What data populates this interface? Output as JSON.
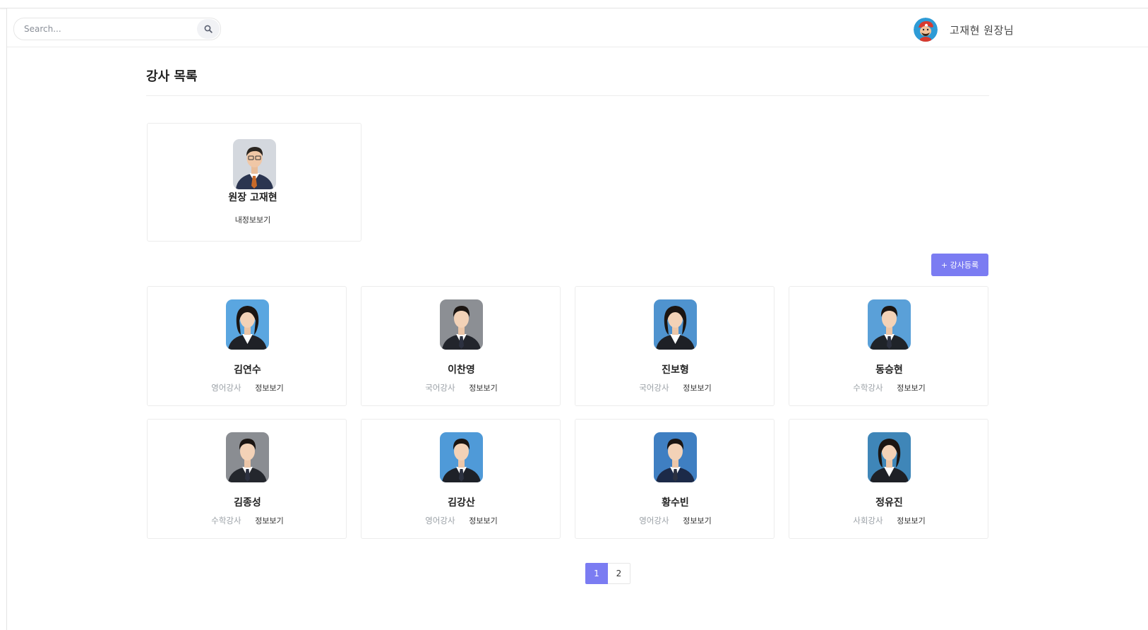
{
  "header": {
    "search_placeholder": "Search...",
    "search_icon": "search-icon",
    "user_avatar_icon": "cartoon-avatar-icon",
    "user_name": "고재현  원장님"
  },
  "page": {
    "title": "강사 목록"
  },
  "director": {
    "name": "원장 고재현",
    "info_link": "내정보보기",
    "suit_color": "#2b3550",
    "tie_color": "#c86a2a",
    "photo_bg": "#d4d8de"
  },
  "add_button_label": "+ 강사등록",
  "instructors": [
    {
      "name": "김연수",
      "subject": "영어강사",
      "link": "정보보기",
      "gender": "f",
      "suit": "#1f2127",
      "bg": "#5aa6e0"
    },
    {
      "name": "이찬영",
      "subject": "국어강사",
      "link": "정보보기",
      "gender": "m",
      "suit": "#22252c",
      "bg": "#8c8f94"
    },
    {
      "name": "진보형",
      "subject": "국어강사",
      "link": "정보보기",
      "gender": "f",
      "suit": "#1e2026",
      "bg": "#4f93cf"
    },
    {
      "name": "동승현",
      "subject": "수학강사",
      "link": "정보보기",
      "gender": "m",
      "suit": "#1f2329",
      "bg": "#5aa0d8"
    },
    {
      "name": "김종성",
      "subject": "수학강사",
      "link": "정보보기",
      "gender": "m",
      "suit": "#24272d",
      "bg": "#8a8d92"
    },
    {
      "name": "김강산",
      "subject": "영어강사",
      "link": "정보보기",
      "gender": "m",
      "suit": "#1e2128",
      "bg": "#4f9ad8"
    },
    {
      "name": "황수빈",
      "subject": "영어강사",
      "link": "정보보기",
      "gender": "m",
      "suit": "#1c2a48",
      "bg": "#3f7fc2"
    },
    {
      "name": "정유진",
      "subject": "사회강사",
      "link": "정보보기",
      "gender": "f",
      "suit": "#1e2026",
      "bg": "#3f86b8"
    }
  ],
  "pagination": {
    "pages": [
      "1",
      "2"
    ],
    "active": "1"
  },
  "colors": {
    "accent": "#7b7cf2",
    "border": "#ececec",
    "muted_text": "#9aa0a6"
  }
}
